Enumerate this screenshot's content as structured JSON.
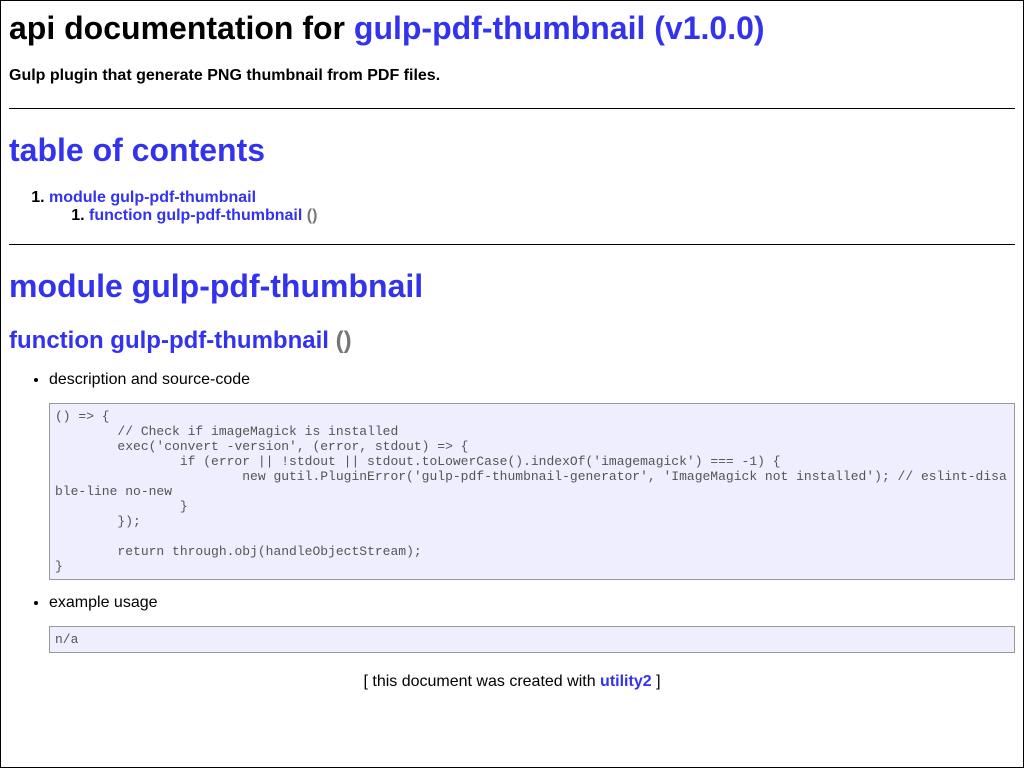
{
  "header": {
    "title_prefix": "api documentation for",
    "package_link": "gulp-pdf-thumbnail (v1.0.0)",
    "description": "Gulp plugin that generate PNG thumbnail from PDF files."
  },
  "toc": {
    "title": "table of contents",
    "module_label": "module gulp-pdf-thumbnail",
    "function_label": "function gulp-pdf-thumbnail",
    "function_parens": "()"
  },
  "module_section": {
    "title": "module gulp-pdf-thumbnail",
    "function_title": "function gulp-pdf-thumbnail",
    "function_parens": "()",
    "item_description_label": "description and source-code",
    "source_code": "() => {\n        // Check if imageMagick is installed\n        exec('convert -version', (error, stdout) => {\n                if (error || !stdout || stdout.toLowerCase().indexOf('imagemagick') === -1) {\n                        new gutil.PluginError('gulp-pdf-thumbnail-generator', 'ImageMagick not installed'); // eslint-disable-line no-new\n                }\n        });\n\n        return through.obj(handleObjectStream);\n}",
    "item_example_label": "example usage",
    "example_code": "n/a"
  },
  "footer": {
    "open_bracket": "[ this document was created with",
    "link": "utility2",
    "close_bracket": "]"
  },
  "colors": {
    "accent": "#3333ee",
    "code_bg": "#eeeeff",
    "muted": "#777777"
  }
}
